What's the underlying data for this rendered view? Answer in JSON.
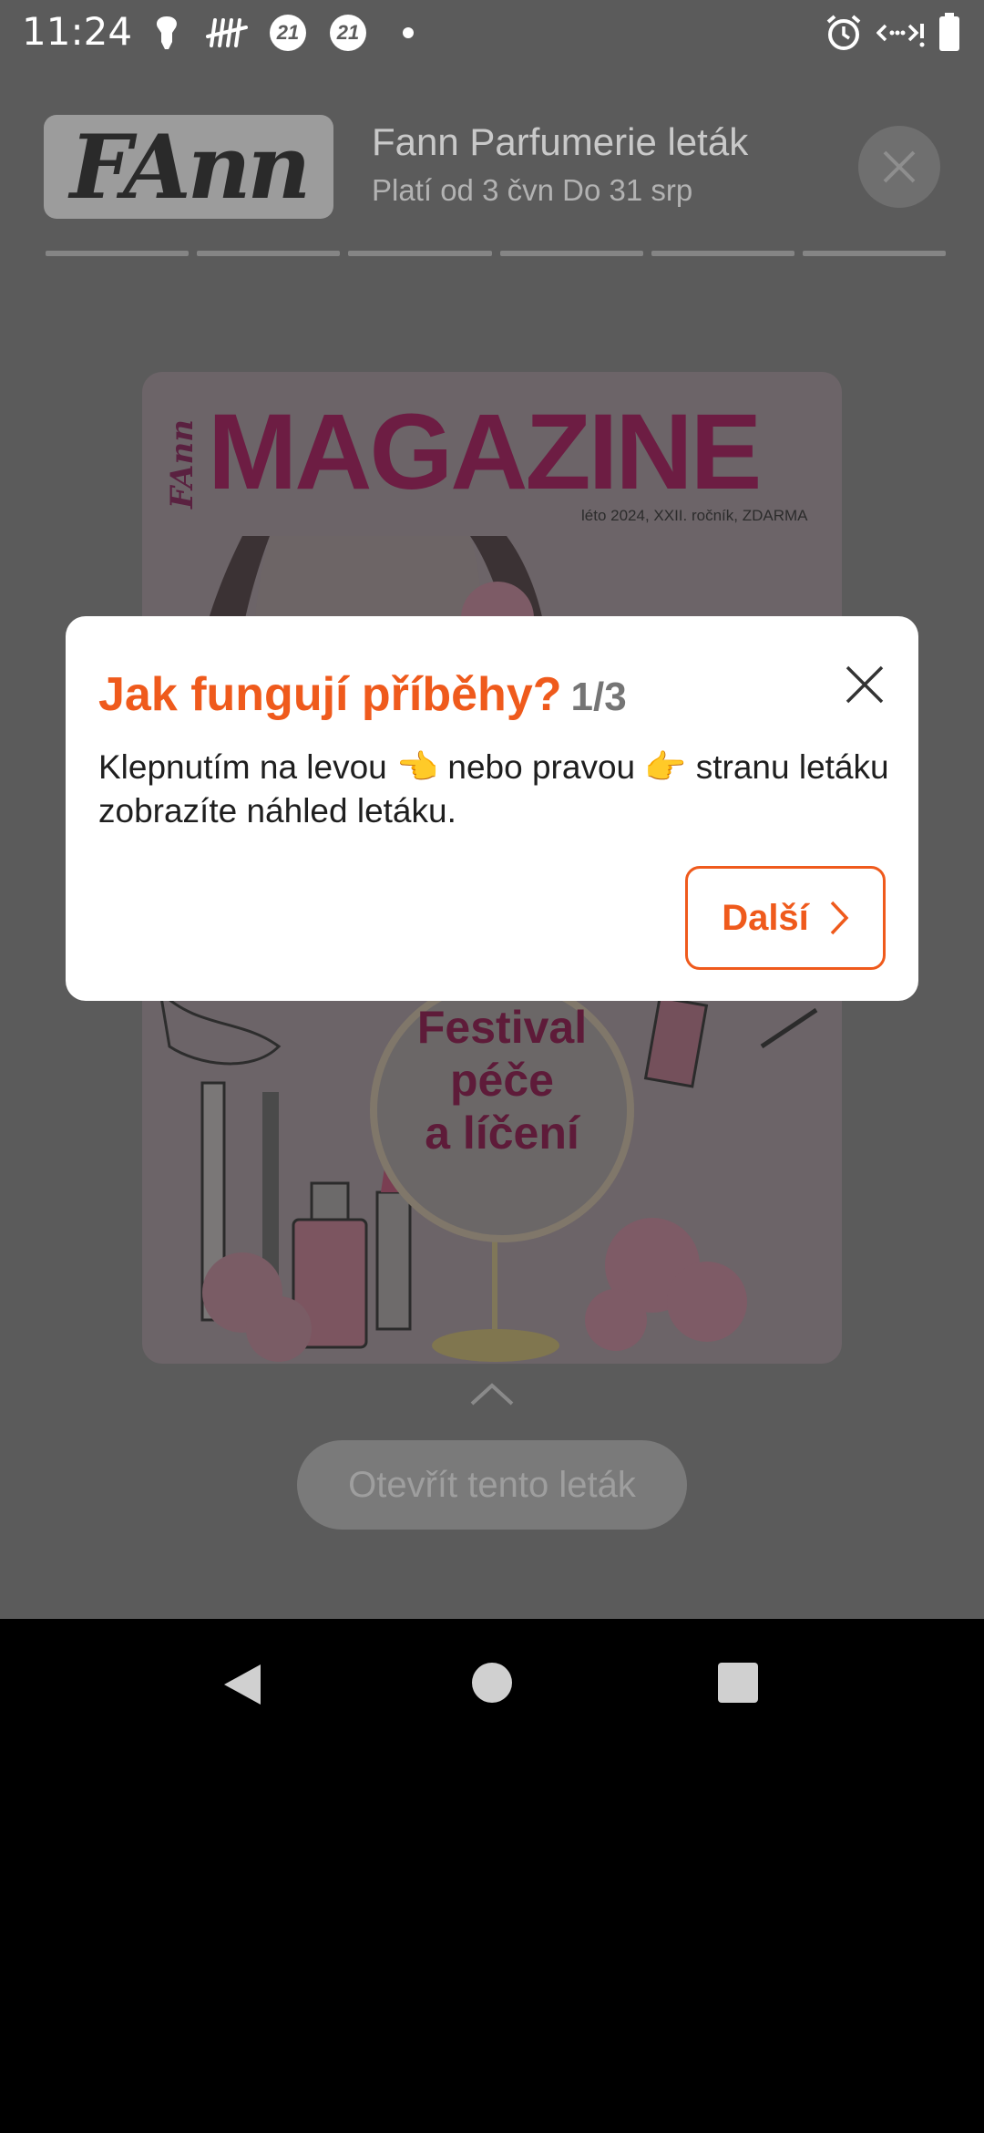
{
  "status_bar": {
    "time": "11:24",
    "badge_1": "21",
    "badge_2": "21",
    "icons": [
      "notification-icon",
      "tally-icon",
      "badge-21-icon",
      "badge-21-icon",
      "dot-icon",
      "alarm-icon",
      "data-icon",
      "battery-icon"
    ]
  },
  "header": {
    "logo_text": "FAnn",
    "title": "Fann Parfumerie leták",
    "validity": "Platí od 3 čvn Do 31 srp",
    "progress_segments": 6
  },
  "flyer": {
    "brand": "FAnn",
    "title": "MAGAZINE",
    "edition": "léto 2024, XXII. ročník, ZDARMA",
    "headline_line1": "Festival",
    "headline_line2": "péče",
    "headline_line3": "a líčení"
  },
  "open_button": {
    "label": "Otevřít tento leták"
  },
  "dialog": {
    "title": "Jak fungují příběhy?",
    "step": "1/3",
    "text": "Klepnutím na levou 👈 nebo pravou 👉 stranu letáku zobrazíte náhled letáku.",
    "next_label": "Další"
  },
  "colors": {
    "accent": "#ef5a1c",
    "overlay_bg": "#5b5b5b",
    "flyer_title": "#6d1d43"
  }
}
